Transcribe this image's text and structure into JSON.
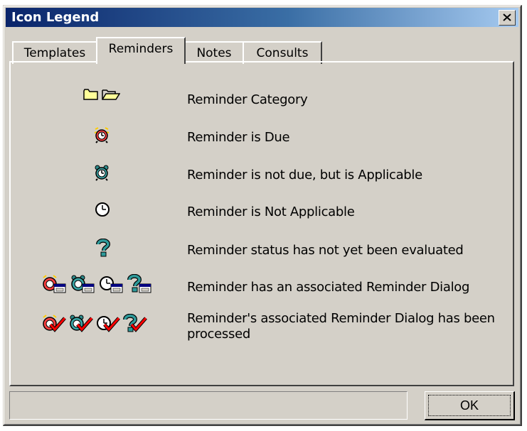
{
  "window": {
    "title": "Icon Legend",
    "close_label": "close"
  },
  "tabs": [
    {
      "label": "Templates",
      "active": false
    },
    {
      "label": "Reminders",
      "active": true
    },
    {
      "label": "Notes",
      "active": false
    },
    {
      "label": "Consults",
      "active": false
    }
  ],
  "legend": [
    {
      "icons": [
        "folder-closed-icon",
        "folder-open-icon"
      ],
      "label": "Reminder Category"
    },
    {
      "icons": [
        "alarm-clock-due-icon"
      ],
      "label": "Reminder is Due"
    },
    {
      "icons": [
        "alarm-clock-applicable-icon"
      ],
      "label": "Reminder is not due, but is Applicable"
    },
    {
      "icons": [
        "clock-not-applicable-icon"
      ],
      "label": "Reminder is Not Applicable"
    },
    {
      "icons": [
        "question-mark-icon"
      ],
      "label": "Reminder status has not yet been evaluated"
    },
    {
      "icons": [
        "due-dialog-icon",
        "applicable-dialog-icon",
        "not-applicable-dialog-icon",
        "question-dialog-icon"
      ],
      "label": "Reminder has an associated Reminder Dialog"
    },
    {
      "icons": [
        "due-processed-icon",
        "applicable-processed-icon",
        "not-applicable-processed-icon",
        "question-processed-icon"
      ],
      "label": "Reminder's associated Reminder Dialog has been processed"
    }
  ],
  "buttons": {
    "ok": "OK"
  },
  "colors": {
    "title_start": "#0a246a",
    "title_end": "#a6caf0",
    "face": "#d4d0c8"
  }
}
